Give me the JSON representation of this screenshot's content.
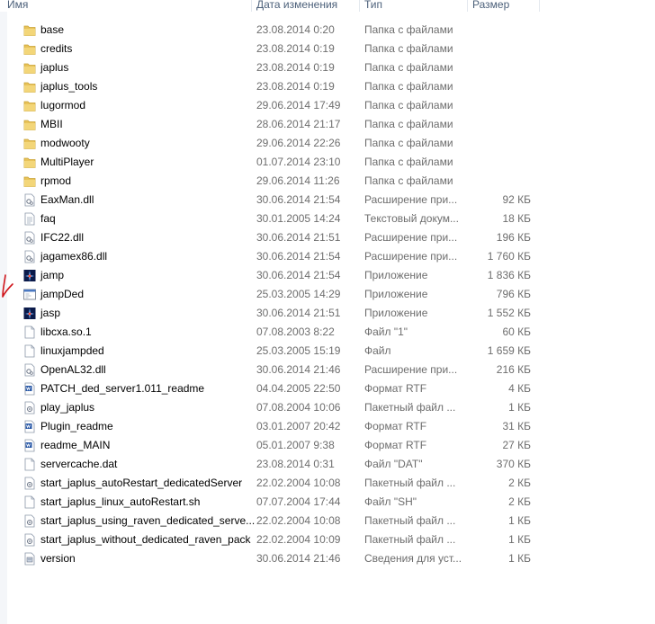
{
  "columns": {
    "name": "Имя",
    "date": "Дата изменения",
    "type": "Тип",
    "size": "Размер"
  },
  "rows": [
    {
      "name": "base",
      "date": "23.08.2014 0:20",
      "type": "Папка с файлами",
      "size": "",
      "icon": "folder-icon"
    },
    {
      "name": "credits",
      "date": "23.08.2014 0:19",
      "type": "Папка с файлами",
      "size": "",
      "icon": "folder-icon"
    },
    {
      "name": "japlus",
      "date": "23.08.2014 0:19",
      "type": "Папка с файлами",
      "size": "",
      "icon": "folder-icon"
    },
    {
      "name": "japlus_tools",
      "date": "23.08.2014 0:19",
      "type": "Папка с файлами",
      "size": "",
      "icon": "folder-icon"
    },
    {
      "name": "lugormod",
      "date": "29.06.2014 17:49",
      "type": "Папка с файлами",
      "size": "",
      "icon": "folder-icon"
    },
    {
      "name": "MBII",
      "date": "28.06.2014 21:17",
      "type": "Папка с файлами",
      "size": "",
      "icon": "folder-icon"
    },
    {
      "name": "modwooty",
      "date": "29.06.2014 22:26",
      "type": "Папка с файлами",
      "size": "",
      "icon": "folder-icon"
    },
    {
      "name": "MultiPlayer",
      "date": "01.07.2014 23:10",
      "type": "Папка с файлами",
      "size": "",
      "icon": "folder-icon"
    },
    {
      "name": "rpmod",
      "date": "29.06.2014 11:26",
      "type": "Папка с файлами",
      "size": "",
      "icon": "folder-icon"
    },
    {
      "name": "EaxMan.dll",
      "date": "30.06.2014 21:54",
      "type": "Расширение при...",
      "size": "92 КБ",
      "icon": "dll-icon"
    },
    {
      "name": "faq",
      "date": "30.01.2005 14:24",
      "type": "Текстовый докум...",
      "size": "18 КБ",
      "icon": "text-file-icon"
    },
    {
      "name": "IFC22.dll",
      "date": "30.06.2014 21:51",
      "type": "Расширение при...",
      "size": "196 КБ",
      "icon": "dll-icon"
    },
    {
      "name": "jagamex86.dll",
      "date": "30.06.2014 21:54",
      "type": "Расширение при...",
      "size": "1 760 КБ",
      "icon": "dll-icon"
    },
    {
      "name": "jamp",
      "date": "30.06.2014 21:54",
      "type": "Приложение",
      "size": "1 836 КБ",
      "icon": "game-exe-icon"
    },
    {
      "name": "jampDed",
      "date": "25.03.2005 14:29",
      "type": "Приложение",
      "size": "796 КБ",
      "icon": "window-exe-icon"
    },
    {
      "name": "jasp",
      "date": "30.06.2014 21:51",
      "type": "Приложение",
      "size": "1 552 КБ",
      "icon": "game-exe-icon"
    },
    {
      "name": "libcxa.so.1",
      "date": "07.08.2003 8:22",
      "type": "Файл \"1\"",
      "size": "60 КБ",
      "icon": "blank-file-icon"
    },
    {
      "name": "linuxjampded",
      "date": "25.03.2005 15:19",
      "type": "Файл",
      "size": "1 659 КБ",
      "icon": "blank-file-icon"
    },
    {
      "name": "OpenAL32.dll",
      "date": "30.06.2014 21:46",
      "type": "Расширение при...",
      "size": "216 КБ",
      "icon": "dll-icon"
    },
    {
      "name": "PATCH_ded_server1.011_readme",
      "date": "04.04.2005 22:50",
      "type": "Формат RTF",
      "size": "4 КБ",
      "icon": "rtf-icon"
    },
    {
      "name": "play_japlus",
      "date": "07.08.2004 10:06",
      "type": "Пакетный файл ...",
      "size": "1 КБ",
      "icon": "batch-icon"
    },
    {
      "name": "Plugin_readme",
      "date": "03.01.2007 20:42",
      "type": "Формат RTF",
      "size": "31 КБ",
      "icon": "rtf-icon"
    },
    {
      "name": "readme_MAIN",
      "date": "05.01.2007 9:38",
      "type": "Формат RTF",
      "size": "27 КБ",
      "icon": "rtf-icon"
    },
    {
      "name": "servercache.dat",
      "date": "23.08.2014 0:31",
      "type": "Файл \"DAT\"",
      "size": "370 КБ",
      "icon": "blank-file-icon"
    },
    {
      "name": "start_japlus_autoRestart_dedicatedServer",
      "date": "22.02.2004 10:08",
      "type": "Пакетный файл ...",
      "size": "2 КБ",
      "icon": "batch-icon"
    },
    {
      "name": "start_japlus_linux_autoRestart.sh",
      "date": "07.07.2004 17:44",
      "type": "Файл \"SH\"",
      "size": "2 КБ",
      "icon": "blank-file-icon"
    },
    {
      "name": "start_japlus_using_raven_dedicated_serve...",
      "date": "22.02.2004 10:08",
      "type": "Пакетный файл ...",
      "size": "1 КБ",
      "icon": "batch-icon"
    },
    {
      "name": "start_japlus_without_dedicated_raven_pack",
      "date": "22.02.2004 10:09",
      "type": "Пакетный файл ...",
      "size": "1 КБ",
      "icon": "batch-icon"
    },
    {
      "name": "version",
      "date": "30.06.2014 21:46",
      "type": "Сведения для уст...",
      "size": "1 КБ",
      "icon": "setup-info-icon"
    }
  ],
  "colors": {
    "header_text": "#4c607a",
    "folder": "#e8c35a",
    "annotation": "#d0161c"
  }
}
